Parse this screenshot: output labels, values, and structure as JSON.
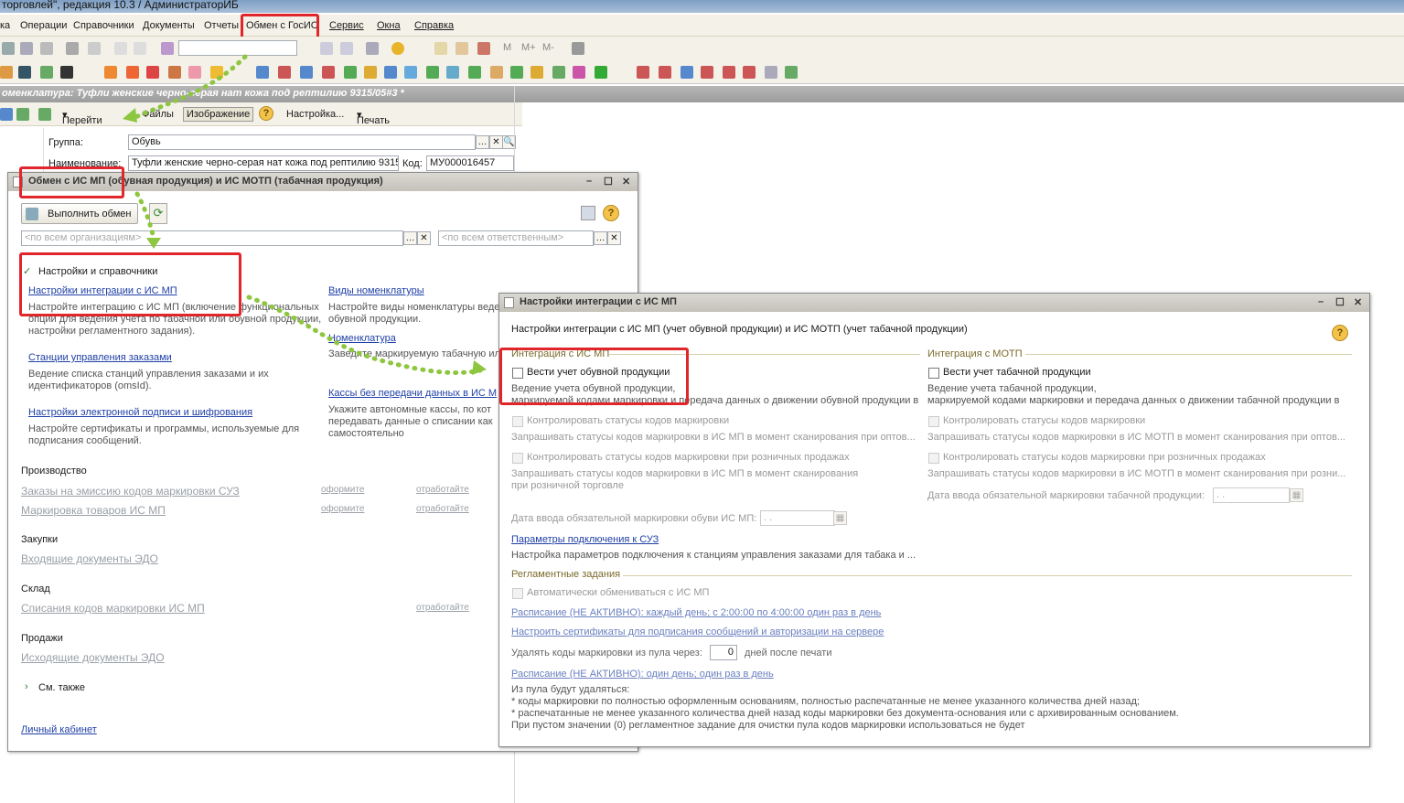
{
  "titlebar": {
    "title": "торговлей\", редакция 10.3 / АдминистраторИБ"
  },
  "menu": [
    "ка",
    "Операции",
    "Справочники",
    "Документы",
    "Отчеты",
    "Обмен с ГосИС",
    "Сервис",
    "Окна",
    "Справка"
  ],
  "doc": {
    "title": "оменклатура: Туфли женские черно-серая нат кожа под рептилию 9315/05#3 *",
    "toolbar": {
      "goto": "Перейти",
      "files": "Файлы",
      "image": "Изображение",
      "settings": "Настройка...",
      "print": "Печать"
    },
    "group_label": "Группа:",
    "group_value": "Обувь",
    "name_label": "Наименование:",
    "name_value": "Туфли женские черно-серая нат кожа под рептилию 9315",
    "code_label": "Код:",
    "code_value": "МУ000016457"
  },
  "exchange": {
    "title": "Обмен с ИС МП (обувная продукция) и ИС МОТП (табачная продукция)",
    "run_button": "Выполнить обмен",
    "org_placeholder": "<по всем организациям>",
    "resp_placeholder": "<по всем ответственным>",
    "settings_header": "Настройки и справочники",
    "link_integration": "Настройки интеграции с ИС МП",
    "desc_integration": [
      "Настройте интеграцию с ИС МП (включение функциональных",
      "опций для ведения учета по табачной или обувной продукции,",
      "настройки регламентного задания)."
    ],
    "link_kinds": "Виды номенклатуры",
    "desc_kinds": [
      "Настройте виды номенклатуры веде",
      "обувной продукции."
    ],
    "link_nomen": "Номенклатура",
    "desc_nomen": "Заведите маркируемую табачную ил",
    "link_stations": "Станции управления заказами",
    "desc_stations": [
      "Ведение списка станций управления заказами и их",
      "идентификаторов (omsId)."
    ],
    "link_kassy": "Кассы без передачи данных в ИС М",
    "desc_kassy": [
      "Укажите автономные кассы, по кот",
      "передавать данные о списании как",
      "самостоятельно"
    ],
    "link_sign": "Настройки электронной подписи и шифрования",
    "desc_sign": [
      "Настройте сертификаты и программы, используемые для",
      "подписания сообщений."
    ],
    "production": "Производство",
    "orders_suz": "Заказы на эмиссию кодов маркировки СУЗ",
    "marking": "Маркировка товаров ИС МП",
    "oformite": "оформите",
    "otrabotaite": "отработайте",
    "purchases": "Закупки",
    "incoming": "Входящие документы ЭДО",
    "warehouse": "Склад",
    "writeoff": "Списания кодов маркировки ИС МП",
    "sales": "Продажи",
    "outgoing": "Исходящие документы ЭДО",
    "see_also": "См. также",
    "cabinet": "Личный кабинет"
  },
  "integration": {
    "title": "Настройки интеграции с ИС МП",
    "subtitle": "Настройки интеграции с ИС МП (учет обувной продукции) и ИС МОТП (учет табачной продукции)",
    "mp_section": "Интеграция с ИС МП",
    "motp_section": "Интеграция с МОТП",
    "mp_check": "Вести учет обувной продукции",
    "mp_desc": [
      "Ведение учета обувной продукции,",
      "маркируемой кодами маркировки и передача данных о движении обувной продукции в"
    ],
    "motp_check": "Вести учет табачной продукции",
    "motp_desc": [
      "Ведение учета табачной продукции,",
      "маркируемой кодами маркировки и передача данных о движении табачной продукции в"
    ],
    "control_status": "Контролировать статусы кодов маркировки",
    "mp_control_desc": "Запрашивать статусы кодов маркировки в ИС МП в момент сканирования при оптов...",
    "motp_control_desc": "Запрашивать статусы кодов маркировки в ИС МОТП в момент сканирования при оптов...",
    "control_retail": "Контролировать статусы кодов маркировки при розничных продажах",
    "mp_retail_desc": [
      "Запрашивать статусы кодов маркировки в ИС МП в момент сканирования",
      "при розничной торговле"
    ],
    "motp_retail_desc": "Запрашивать статусы кодов маркировки в ИС МОТП в момент сканирования при розни...",
    "shoe_date": "Дата ввода обязательной маркировки обуви ИС МП:",
    "tobacco_date": "Дата ввода обязательной маркировки табачной продукции:",
    "date_placeholder": " .  .",
    "suz_link": "Параметры подключения к СУЗ",
    "suz_desc": "Настройка параметров подключения к станциям управления заказами для табака и ...",
    "sched_section": "Регламентные задания",
    "auto_exchange": "Автоматически обмениваться с ИС МП",
    "sched1": "Расписание (НЕ АКТИВНО): каждый день; с 2:00:00 по 4:00:00 один раз в день",
    "certs": "Настроить сертификаты для подписания сообщений и авторизации на сервере",
    "delete_label": "Удалять коды маркировки из пула через:",
    "delete_value": "0",
    "delete_suffix": "дней после печати",
    "sched2": "Расписание (НЕ АКТИВНО): один день; один раз в день",
    "notes": [
      "Из пула будут удаляться:",
      " * коды маркировки по полностью оформленным основаниям, полностью  распечатанные не менее указанного количества дней назад;",
      " * распечатанные не менее указанного количества дней назад коды маркировки без документа-основания или с архивированным основанием.",
      "При пустом значении (0) регламентное задание для очистки пула кодов маркировки использоваться не будет"
    ]
  },
  "colors": {
    "highlight": "#e0262b",
    "arrow": "#8dc63f",
    "link": "#1f3fa6"
  }
}
